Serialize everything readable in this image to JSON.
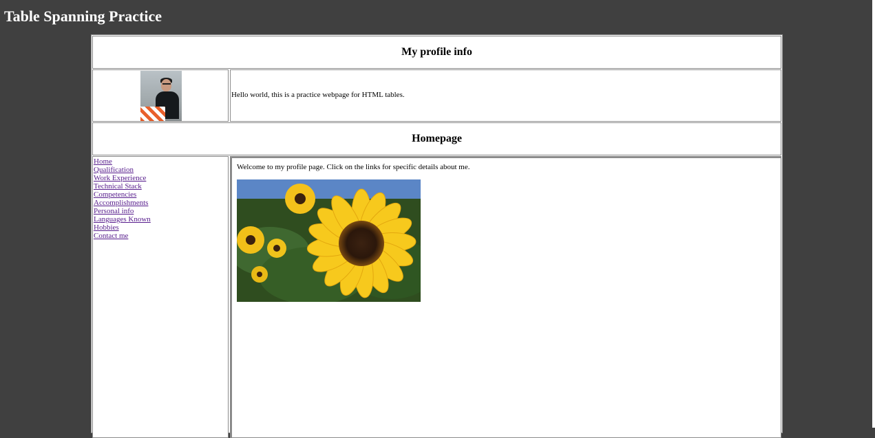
{
  "page": {
    "title": "Table Spanning Practice"
  },
  "profile_table": {
    "profile_header": "My profile info",
    "avatar_alt": "Profile photo",
    "intro": "Hello world, this is a practice webpage for HTML tables.",
    "homepage_header": "Homepage"
  },
  "sidebar": {
    "links": [
      "Home",
      "Qualification",
      "Work Experience",
      "Technical Stack",
      "Competencies",
      "Accomplishments",
      "Personal info",
      "Languages Known",
      "Hobbies",
      "Contact me"
    ]
  },
  "main": {
    "welcome": "Welcome to my profile page. Click on the links for specific details about me.",
    "image": "sunflower-photo"
  },
  "colors": {
    "page_background": "#404040",
    "title_text": "#ffffff",
    "visited_link": "#551a8b",
    "cell_border": "#8a8a8a"
  }
}
